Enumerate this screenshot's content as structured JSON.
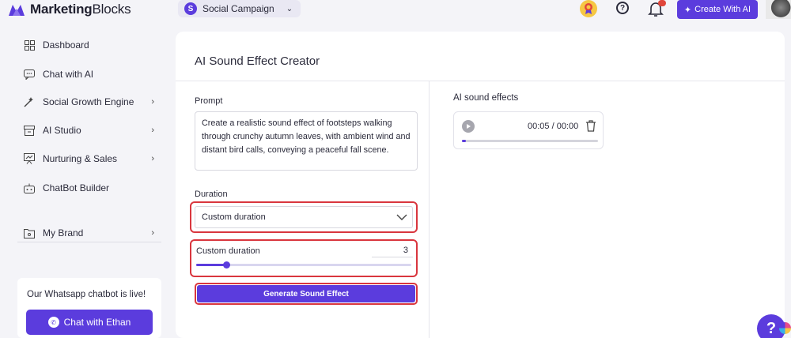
{
  "header": {
    "brand_bold": "Marketing",
    "brand_light": "Blocks",
    "campaign_initial": "S",
    "campaign_name": "Social Campaign",
    "create_ai_label": "Create With AI",
    "help_glyph": "?"
  },
  "sidebar": {
    "items": [
      {
        "label": "Dashboard",
        "icon": "grid-icon"
      },
      {
        "label": "Chat with AI",
        "icon": "chat-icon"
      },
      {
        "label": "Social Growth Engine",
        "icon": "magic-wand-icon"
      },
      {
        "label": "AI Studio",
        "icon": "storefront-icon"
      },
      {
        "label": "Nurturing & Sales",
        "icon": "presentation-icon"
      },
      {
        "label": "ChatBot Builder",
        "icon": "robot-icon"
      },
      {
        "label": "My Brand",
        "icon": "folder-icon"
      }
    ],
    "promo": {
      "text": "Our Whatsapp chatbot is live!",
      "button_label": "Chat with Ethan"
    }
  },
  "main": {
    "title": "AI Sound Effect Creator",
    "prompt_label": "Prompt",
    "prompt_value": "Create a realistic sound effect of footsteps walking through crunchy autumn leaves, with ambient wind and distant bird calls, conveying a peaceful fall scene.",
    "duration_label": "Duration",
    "duration_selected": "Custom duration",
    "custom_label": "Custom duration",
    "custom_value": "3",
    "custom_slider_fraction": 0.14,
    "generate_label": "Generate Sound Effect",
    "results_title": "AI sound effects",
    "audio_time": "00:05 / 00:00",
    "audio_progress_fraction": 0.03
  },
  "colors": {
    "accent": "#5b3cdd",
    "highlight_border": "#d9363e"
  }
}
